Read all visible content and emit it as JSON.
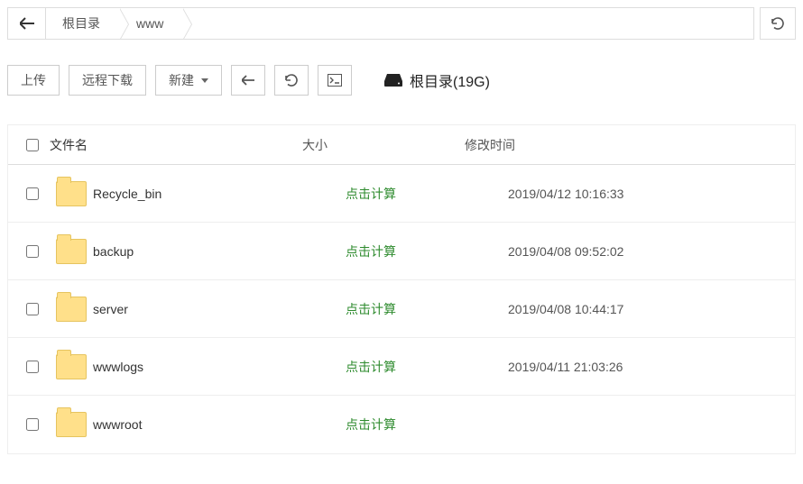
{
  "breadcrumb": {
    "segments": [
      "根目录",
      "www"
    ]
  },
  "toolbar": {
    "upload_label": "上传",
    "remote_download_label": "远程下载",
    "new_label": "新建"
  },
  "disk": {
    "label": "根目录(19G)"
  },
  "table": {
    "headers": {
      "name": "文件名",
      "size": "大小",
      "mtime": "修改时间"
    },
    "size_placeholder": "点击计算",
    "rows": [
      {
        "name": "Recycle_bin",
        "mtime": "2019/04/12 10:16:33"
      },
      {
        "name": "backup",
        "mtime": "2019/04/08 09:52:02"
      },
      {
        "name": "server",
        "mtime": "2019/04/08 10:44:17"
      },
      {
        "name": "wwwlogs",
        "mtime": "2019/04/11 21:03:26"
      },
      {
        "name": "wwwroot",
        "mtime": ""
      }
    ]
  }
}
